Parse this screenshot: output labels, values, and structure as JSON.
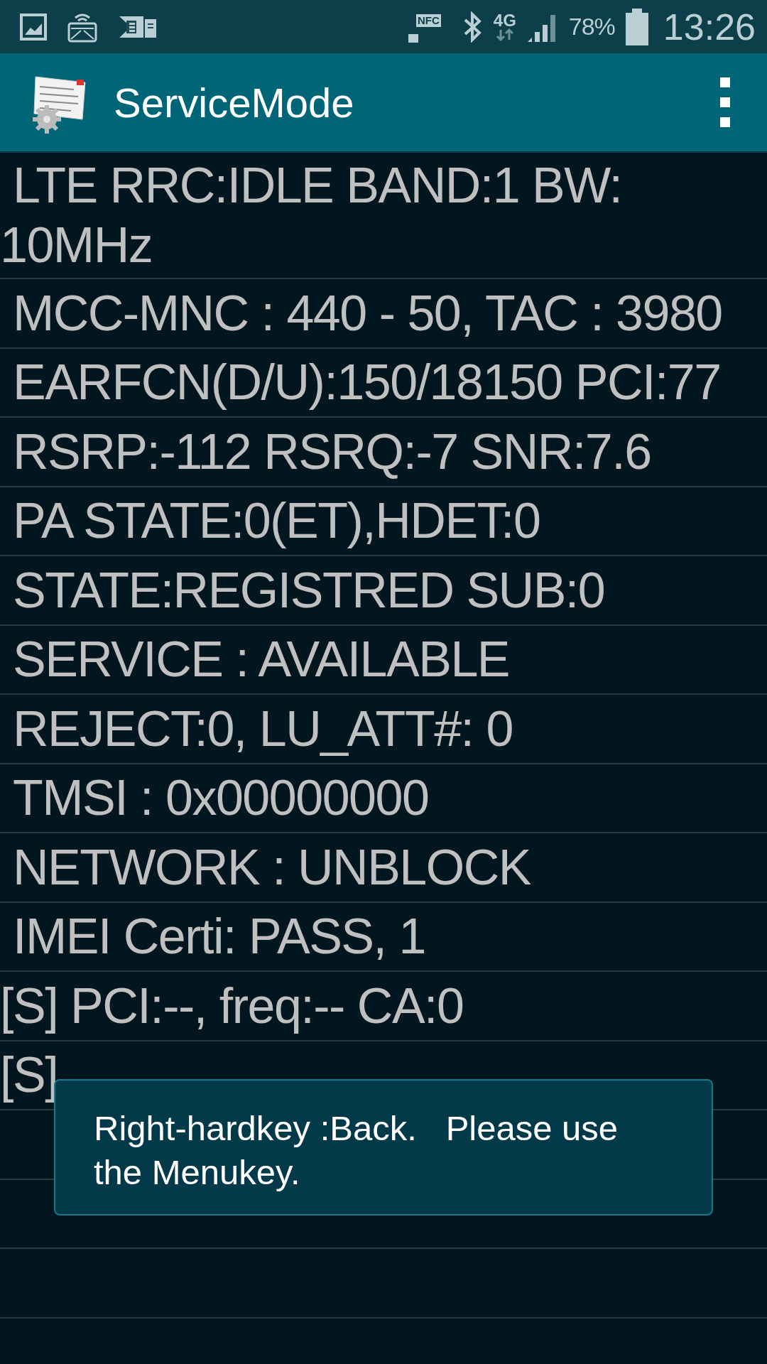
{
  "status_bar": {
    "nfc_label": "NFC",
    "network_type": "4G",
    "battery": "78%",
    "time": "13:26"
  },
  "app_bar": {
    "title": "ServiceMode"
  },
  "rows": [
    " LTE RRC:IDLE BAND:1 BW: 10MHz",
    " MCC-MNC : 440 - 50, TAC : 3980",
    " EARFCN(D/U):150/18150 PCI:77",
    " RSRP:-112 RSRQ:-7 SNR:7.6",
    " PA STATE:0(ET),HDET:0",
    " STATE:REGISTRED SUB:0",
    " SERVICE : AVAILABLE",
    " REJECT:0, LU_ATT#: 0",
    " TMSI : 0x00000000",
    " NETWORK : UNBLOCK",
    " IMEI Certi: PASS, 1",
    "[S] PCI:--, freq:-- CA:0",
    "[S]"
  ],
  "toast": {
    "message": "Right-hardkey :Back.   Please use the Menukey."
  }
}
